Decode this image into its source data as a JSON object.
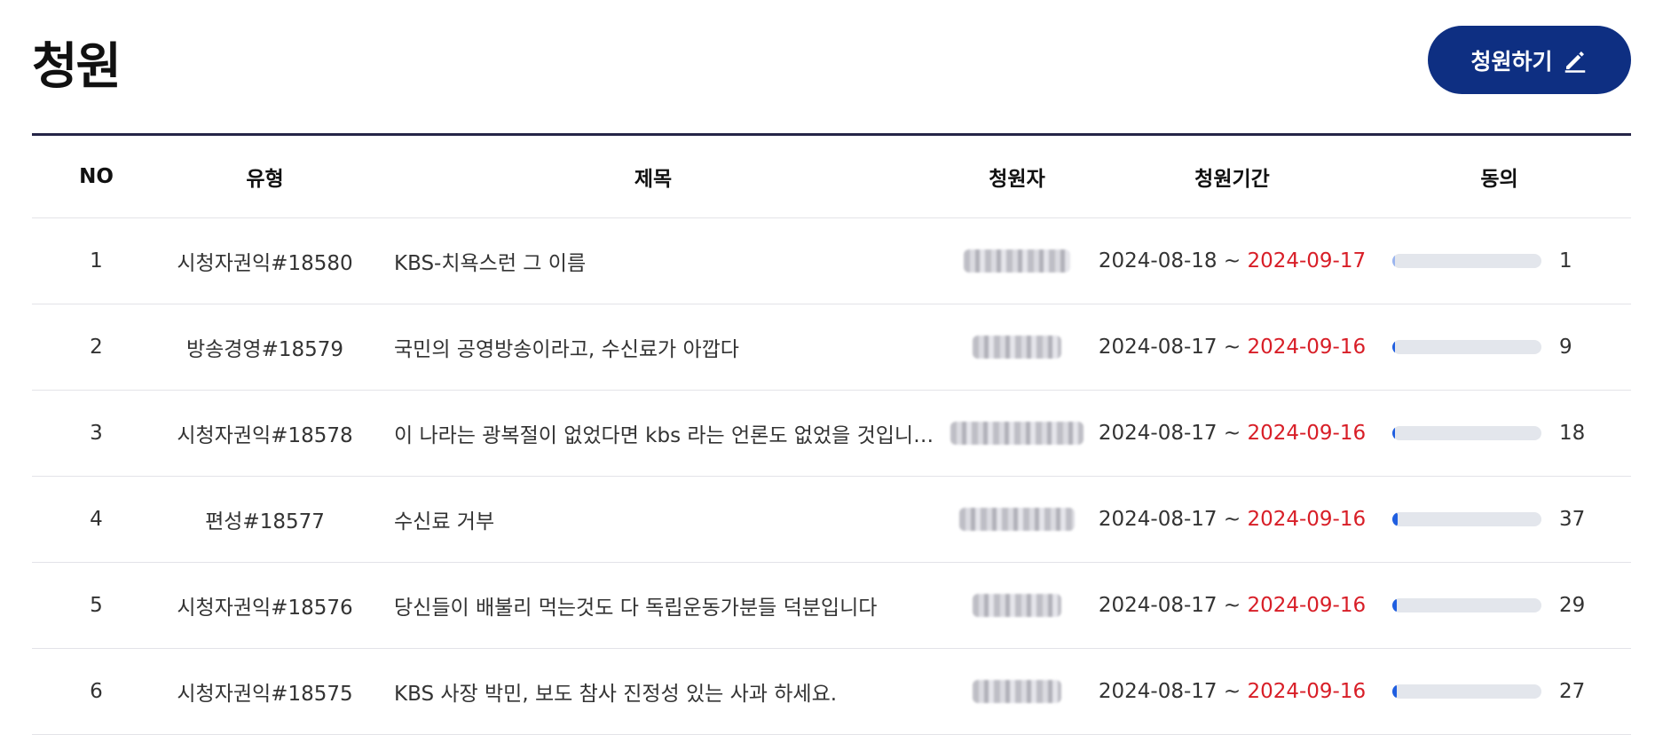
{
  "page": {
    "title": "청원"
  },
  "write_button": {
    "label": "청원하기",
    "icon": "pencil-icon",
    "color": "#0e2f82"
  },
  "table": {
    "headers": {
      "no": "NO",
      "type": "유형",
      "title": "제목",
      "author": "청원자",
      "period": "청원기간",
      "agree": "동의"
    },
    "accent_color": "#d81e27",
    "rows": [
      {
        "no": "1",
        "type": "시청자권익#18580",
        "title": "KBS-치욕스런 그 이름",
        "start": "2024-08-18",
        "sep": "~",
        "end": "2024-09-17",
        "agree": "1",
        "agree_fraction": 0.003
      },
      {
        "no": "2",
        "type": "방송경영#18579",
        "title": "국민의 공영방송이라고, 수신료가 아깝다",
        "start": "2024-08-17",
        "sep": "~",
        "end": "2024-09-16",
        "agree": "9",
        "agree_fraction": 0.01
      },
      {
        "no": "3",
        "type": "시청자권익#18578",
        "title": "이 나라는 광복절이 없었다면 kbs 라는 언론도 없었을 것입니…",
        "start": "2024-08-17",
        "sep": "~",
        "end": "2024-09-16",
        "agree": "18",
        "agree_fraction": 0.02
      },
      {
        "no": "4",
        "type": "편성#18577",
        "title": "수신료 거부",
        "start": "2024-08-17",
        "sep": "~",
        "end": "2024-09-16",
        "agree": "37",
        "agree_fraction": 0.037
      },
      {
        "no": "5",
        "type": "시청자권익#18576",
        "title": "당신들이 배불리 먹는것도 다 독립운동가분들 덕분입니다",
        "start": "2024-08-17",
        "sep": "~",
        "end": "2024-09-16",
        "agree": "29",
        "agree_fraction": 0.029
      },
      {
        "no": "6",
        "type": "시청자권익#18575",
        "title": "KBS 사장 박민, 보도 참사 진정성 있는 사과 하세요.",
        "start": "2024-08-17",
        "sep": "~",
        "end": "2024-09-16",
        "agree": "27",
        "agree_fraction": 0.027
      }
    ]
  }
}
